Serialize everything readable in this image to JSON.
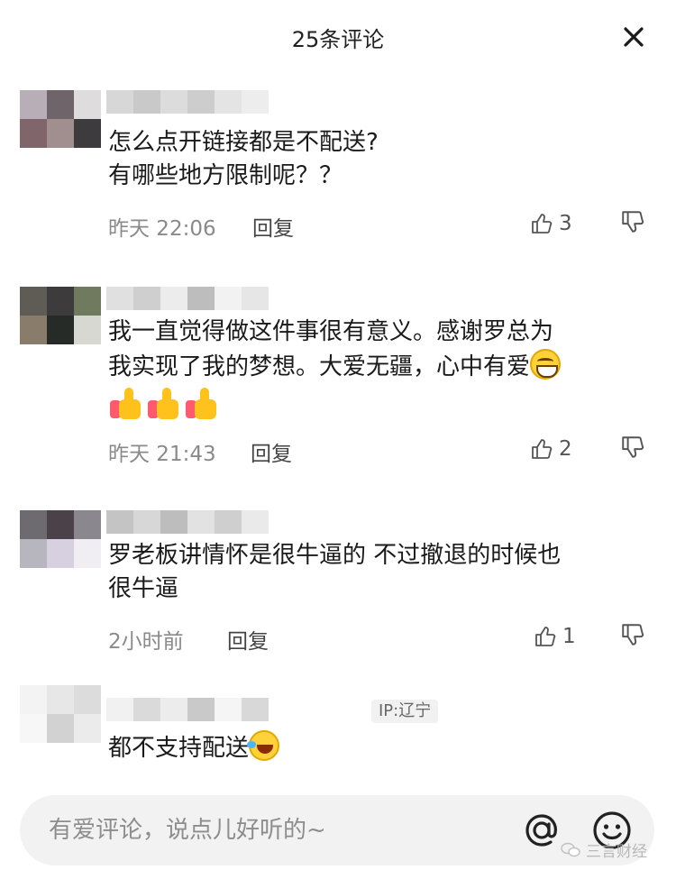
{
  "header": {
    "title": "25条评论",
    "close_icon": "close-icon"
  },
  "comments": [
    {
      "avatar_colors": [
        "#b7aeb8",
        "#6f6469",
        "#dedcdd",
        "#80666a",
        "#a18e8e",
        "#3d3b3e"
      ],
      "username_colors": [
        "#d7d7d7",
        "#c9c9c9",
        "#dcdcdc",
        "#cdcdcd",
        "#e4e4e4",
        "#ededed"
      ],
      "text_lines": [
        "怎么点开链接都是不配送?",
        "有哪些地方限制呢？？"
      ],
      "time": "昨天 22:06",
      "reply": "回复",
      "likes": "3"
    },
    {
      "avatar_colors": [
        "#5f5c55",
        "#3e3b3c",
        "#6f7a5f",
        "#8a7c6a",
        "#262b27",
        "#d8d8d2"
      ],
      "username_colors": [
        "#e0e0e0",
        "#cfcfcf",
        "#ececec",
        "#bdbdbd",
        "#f2f2f2",
        "#e6e6e6"
      ],
      "text_lines": [
        "我一直觉得做这件事很有意义。感谢罗总为",
        "我实现了我的梦想。大爱无疆，心中有爱"
      ],
      "time": "昨天 21:43",
      "reply": "回复",
      "likes": "2"
    },
    {
      "avatar_colors": [
        "#6d6a70",
        "#4b4148",
        "#8a878f",
        "#b7b5bd",
        "#d7d0e0",
        "#f0eef3"
      ],
      "username_colors": [
        "#c4c4c4",
        "#d7d7d7",
        "#bdbdbd",
        "#e2e2e2",
        "#cfcfcf",
        "#eaeaea"
      ],
      "text_lines": [
        "罗老板讲情怀是很牛逼的 不过撤退的时候也",
        "很牛逼"
      ],
      "time": "2小时前",
      "reply": "回复",
      "likes": "1"
    },
    {
      "avatar_colors": [
        "#f3f3f3",
        "#e7e7e7",
        "#dcdcdc",
        "#f7f7f7",
        "#d2d2d2",
        "#ebebeb"
      ],
      "username_colors": [
        "#f1f1f1",
        "#dadada",
        "#ececec",
        "#c9c9c9",
        "#f5f5f5",
        "#d8d8d8"
      ],
      "ip": "IP:辽宁",
      "text_lines": [
        "都不支持配送"
      ]
    }
  ],
  "input": {
    "placeholder": "有爱评论，说点儿好听的~"
  },
  "watermark": {
    "text": "三言财经"
  },
  "colors": {
    "accent_like": "#555555",
    "input_bg": "#f2f2f2"
  }
}
